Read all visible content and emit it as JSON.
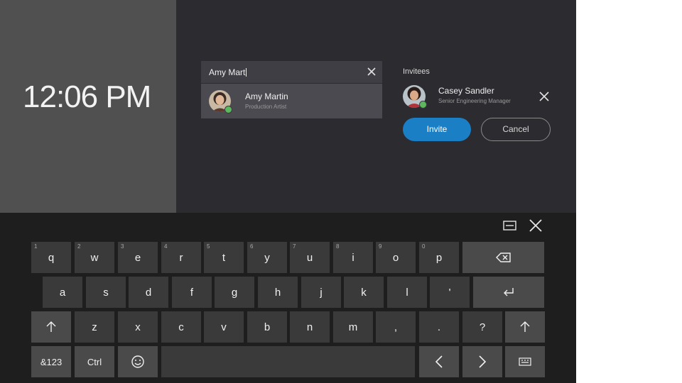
{
  "lock": {
    "time": "12:06 PM"
  },
  "search": {
    "query": "Amy Mart"
  },
  "search_result": {
    "name": "Amy Martin",
    "title": "Production Artist"
  },
  "invitees": {
    "label": "Invitees",
    "items": [
      {
        "name": "Casey Sandler",
        "title": "Senior Engineering Manager"
      }
    ]
  },
  "actions": {
    "invite": "Invite",
    "cancel": "Cancel"
  },
  "keyboard": {
    "row1": [
      {
        "label": "q",
        "hint": "1"
      },
      {
        "label": "w",
        "hint": "2"
      },
      {
        "label": "e",
        "hint": "3"
      },
      {
        "label": "r",
        "hint": "4"
      },
      {
        "label": "t",
        "hint": "5"
      },
      {
        "label": "y",
        "hint": "6"
      },
      {
        "label": "u",
        "hint": "7"
      },
      {
        "label": "i",
        "hint": "8"
      },
      {
        "label": "o",
        "hint": "9"
      },
      {
        "label": "p",
        "hint": "0"
      }
    ],
    "row2": [
      "a",
      "s",
      "d",
      "f",
      "g",
      "h",
      "j",
      "k",
      "l",
      "'"
    ],
    "row3": [
      "z",
      "x",
      "c",
      "v",
      "b",
      "n",
      "m",
      ",",
      ".",
      "?"
    ],
    "numbers_key": "&123",
    "ctrl_key": "Ctrl"
  },
  "colors": {
    "accent": "#1a7fc4",
    "presence": "#5cb85c",
    "background": "#2b2b30",
    "keyboard": "#1e1e1e"
  },
  "icons": [
    "clear-icon",
    "close-icon",
    "backspace-icon",
    "enter-icon",
    "shift-icon",
    "emoji-icon",
    "arrow-left-icon",
    "arrow-right-icon",
    "keyboard-icon",
    "dock-keyboard-icon",
    "close-keyboard-icon"
  ]
}
